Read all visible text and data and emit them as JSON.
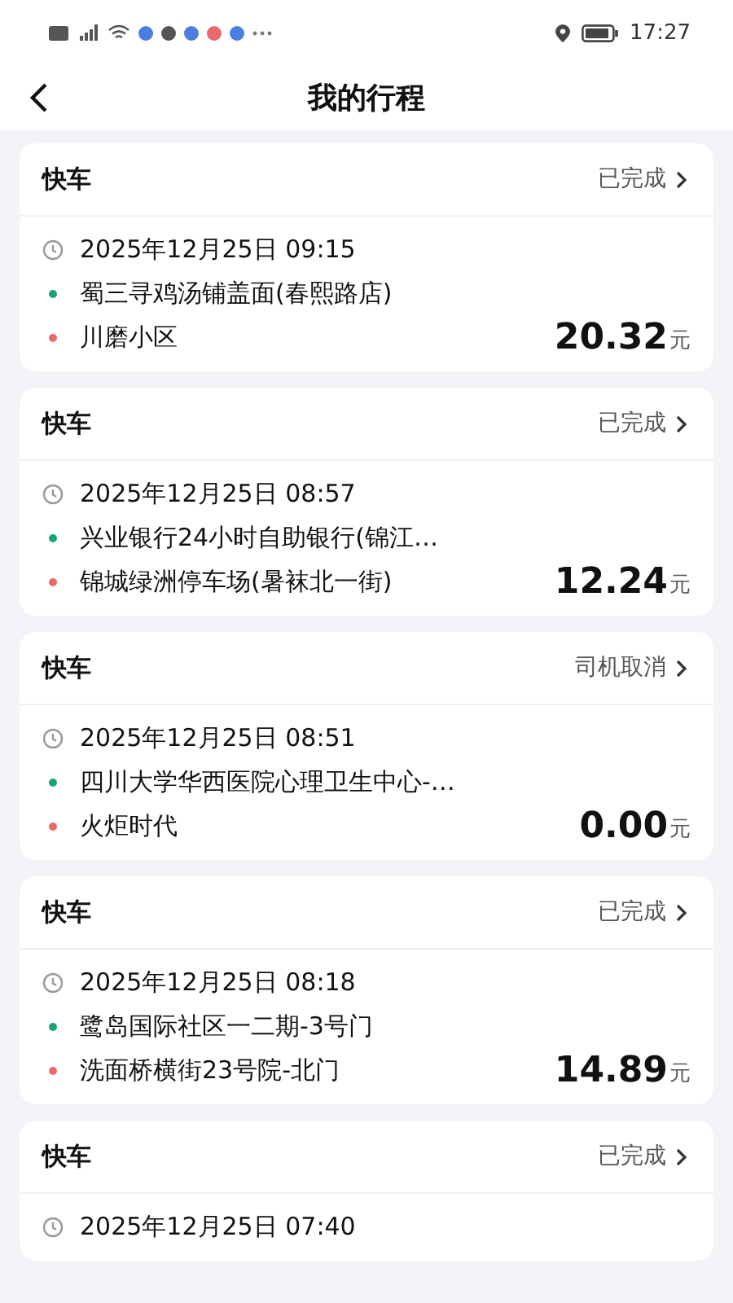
{
  "status_bar": {
    "time": "17:27"
  },
  "header": {
    "title": "我的行程"
  },
  "trips": [
    {
      "type": "快车",
      "status": "已完成",
      "time": "2025年12月25日 09:15",
      "from": "蜀三寻鸡汤铺盖面(春熙路店)",
      "to": "川磨小区",
      "price": "20.32",
      "unit": "元"
    },
    {
      "type": "快车",
      "status": "已完成",
      "time": "2025年12月25日 08:57",
      "from": "兴业银行24小时自助银行(锦江…",
      "to": "锦城绿洲停车场(暑袜北一街)",
      "price": "12.24",
      "unit": "元"
    },
    {
      "type": "快车",
      "status": "司机取消",
      "time": "2025年12月25日 08:51",
      "from": "四川大学华西医院心理卫生中心-…",
      "to": "火炬时代",
      "price": "0.00",
      "unit": "元"
    },
    {
      "type": "快车",
      "status": "已完成",
      "time": "2025年12月25日 08:18",
      "from": "鹭岛国际社区一二期-3号门",
      "to": "洗面桥横街23号院-北门",
      "price": "14.89",
      "unit": "元"
    },
    {
      "type": "快车",
      "status": "已完成",
      "time": "2025年12月25日 07:40"
    }
  ]
}
